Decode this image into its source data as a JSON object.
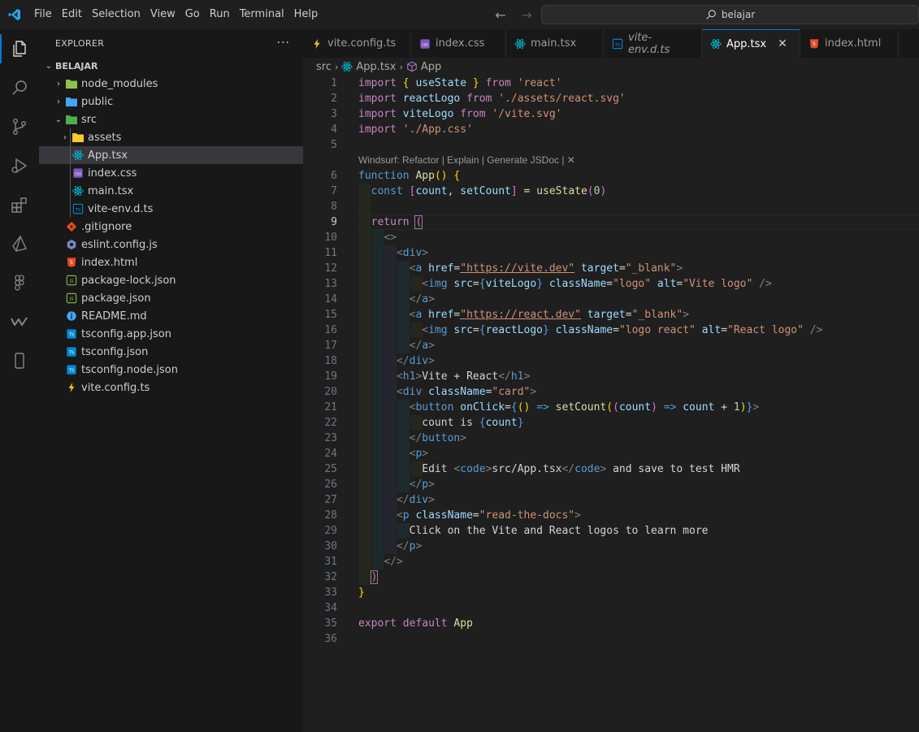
{
  "menu": [
    "File",
    "Edit",
    "Selection",
    "View",
    "Go",
    "Run",
    "Terminal",
    "Help"
  ],
  "search": {
    "text": "belajar"
  },
  "sidebar": {
    "title": "EXPLORER",
    "more": "···",
    "folder": "BELAJAR",
    "items": [
      {
        "label": "node_modules",
        "type": "folder",
        "chev": "›",
        "depth": 1,
        "icon": "node-modules-folder-icon",
        "color": "#8bc34a"
      },
      {
        "label": "public",
        "type": "folder",
        "chev": "›",
        "depth": 1,
        "icon": "public-folder-icon",
        "color": "#42a5f5"
      },
      {
        "label": "src",
        "type": "folder",
        "chev": "⌄",
        "depth": 1,
        "icon": "src-folder-icon",
        "color": "#4caf50"
      },
      {
        "label": "assets",
        "type": "folder",
        "chev": "›",
        "depth": 2,
        "icon": "assets-folder-icon",
        "color": "#ffca28"
      },
      {
        "label": "App.tsx",
        "type": "file",
        "depth": 2,
        "icon": "react-icon",
        "color": "#00bcd4",
        "selected": true
      },
      {
        "label": "index.css",
        "type": "file",
        "depth": 2,
        "icon": "css-file-icon",
        "color": "#7e57c2"
      },
      {
        "label": "main.tsx",
        "type": "file",
        "depth": 2,
        "icon": "react-icon",
        "color": "#00bcd4"
      },
      {
        "label": "vite-env.d.ts",
        "type": "file",
        "depth": 2,
        "icon": "ts-file-icon",
        "color": "#0288d1"
      },
      {
        "label": ".gitignore",
        "type": "file",
        "depth": 1,
        "icon": "git-icon",
        "color": "#e64a19"
      },
      {
        "label": "eslint.config.js",
        "type": "file",
        "depth": 1,
        "icon": "eslint-icon",
        "color": "#7986cb"
      },
      {
        "label": "index.html",
        "type": "file",
        "depth": 1,
        "icon": "html-file-icon",
        "color": "#e44d26"
      },
      {
        "label": "package-lock.json",
        "type": "file",
        "depth": 1,
        "icon": "npm-icon",
        "color": "#8bc34a"
      },
      {
        "label": "package.json",
        "type": "file",
        "depth": 1,
        "icon": "npm-icon",
        "color": "#8bc34a"
      },
      {
        "label": "README.md",
        "type": "file",
        "depth": 1,
        "icon": "info-icon",
        "color": "#42a5f5"
      },
      {
        "label": "tsconfig.app.json",
        "type": "file",
        "depth": 1,
        "icon": "tsconfig-icon",
        "color": "#0288d1"
      },
      {
        "label": "tsconfig.json",
        "type": "file",
        "depth": 1,
        "icon": "tsconfig-icon",
        "color": "#0288d1"
      },
      {
        "label": "tsconfig.node.json",
        "type": "file",
        "depth": 1,
        "icon": "tsconfig-icon",
        "color": "#0288d1"
      },
      {
        "label": "vite.config.ts",
        "type": "file",
        "depth": 1,
        "icon": "vite-icon",
        "color": "#ffc107"
      }
    ]
  },
  "tabs": [
    {
      "label": "vite.config.ts",
      "icon": "vite-icon",
      "width": 133
    },
    {
      "label": "index.css",
      "icon": "css-file-icon",
      "width": 117
    },
    {
      "label": "main.tsx",
      "icon": "react-icon",
      "width": 120
    },
    {
      "label": "vite-env.d.ts",
      "icon": "ts-file-icon",
      "italic": true,
      "width": 121
    },
    {
      "label": "App.tsx",
      "icon": "react-icon",
      "active": true,
      "close": "✕",
      "width": 121
    },
    {
      "label": "index.html",
      "icon": "html-file-icon",
      "width": 121
    }
  ],
  "breadcrumb": {
    "folder": "src",
    "file": "App.tsx",
    "symbol": "App"
  },
  "codelens": "Windsurf: Refactor | Explain | Generate JSDoc | ✕",
  "line_numbers": [
    "1",
    "2",
    "3",
    "4",
    "5",
    "6",
    "7",
    "8",
    "9",
    "10",
    "11",
    "12",
    "13",
    "14",
    "15",
    "16",
    "17",
    "18",
    "19",
    "20",
    "21",
    "22",
    "23",
    "24",
    "25",
    "26",
    "27",
    "28",
    "29",
    "30",
    "31",
    "32",
    "33",
    "34",
    "35",
    "36"
  ],
  "code": {
    "l1": [
      "import",
      "{",
      "useState",
      "}",
      "from",
      "'react'"
    ],
    "l2": [
      "import",
      "reactLogo",
      "from",
      "'./assets/react.svg'"
    ],
    "l3": [
      "import",
      "viteLogo",
      "from",
      "'/vite.svg'"
    ],
    "l4": [
      "import",
      "'./App.css'"
    ],
    "l6": [
      "function",
      "App",
      "()",
      "{"
    ],
    "l7": [
      "const",
      "[",
      "count",
      ",",
      "setCount",
      "]",
      "=",
      "useState",
      "(",
      "0",
      ")"
    ],
    "l9": [
      "return",
      "("
    ],
    "l10": [
      "<>"
    ],
    "l11": [
      "<",
      "div",
      ">"
    ],
    "l12": [
      "<",
      "a",
      "href",
      "=",
      "\"https://vite.dev\"",
      "target",
      "=",
      "\"_blank\"",
      ">"
    ],
    "l13": [
      "<",
      "img",
      "src",
      "=",
      "{",
      "viteLogo",
      "}",
      "className",
      "=",
      "\"logo\"",
      "alt",
      "=",
      "\"Vite logo\"",
      "/>"
    ],
    "l14": [
      "</",
      "a",
      ">"
    ],
    "l15": [
      "<",
      "a",
      "href",
      "=",
      "\"https://react.dev\"",
      "target",
      "=",
      "\"_blank\"",
      ">"
    ],
    "l16": [
      "<",
      "img",
      "src",
      "=",
      "{",
      "reactLogo",
      "}",
      "className",
      "=",
      "\"logo react\"",
      "alt",
      "=",
      "\"React logo\"",
      "/>"
    ],
    "l17": [
      "</",
      "a",
      ">"
    ],
    "l18": [
      "</",
      "div",
      ">"
    ],
    "l19": [
      "<",
      "h1",
      ">",
      "Vite + React",
      "</",
      "h1",
      ">"
    ],
    "l20": [
      "<",
      "div",
      "className",
      "=",
      "\"card\"",
      ">"
    ],
    "l21": [
      "<",
      "button",
      "onClick",
      "=",
      "{",
      "(",
      ")",
      "=>",
      "setCount",
      "(",
      "(",
      "count",
      ")",
      "=>",
      "count",
      "+",
      "1",
      ")",
      "}",
      ">"
    ],
    "l22": [
      "count is",
      "{",
      "count",
      "}"
    ],
    "l23": [
      "</",
      "button",
      ">"
    ],
    "l24": [
      "<",
      "p",
      ">"
    ],
    "l25": [
      "Edit",
      "<",
      "code",
      ">",
      "src/App.tsx",
      "</",
      "code",
      ">",
      "and save to test HMR"
    ],
    "l26": [
      "</",
      "p",
      ">"
    ],
    "l27": [
      "</",
      "div",
      ">"
    ],
    "l28": [
      "<",
      "p",
      "className",
      "=",
      "\"read-the-docs\"",
      ">"
    ],
    "l29": [
      "Click on the Vite and React logos to learn more"
    ],
    "l30": [
      "</",
      "p",
      ">"
    ],
    "l31": [
      "</>"
    ],
    "l32": [
      ")"
    ],
    "l33": [
      "}"
    ],
    "l35": [
      "export",
      "default",
      "App"
    ]
  }
}
